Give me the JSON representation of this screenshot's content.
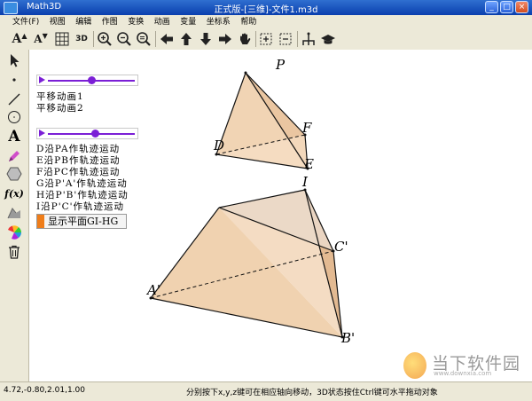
{
  "window": {
    "app_name": "Math3D",
    "title": "正式版-[三维]-文件1.m3d",
    "controls": [
      "_",
      "□",
      "×"
    ]
  },
  "menu": [
    "文件(F)",
    "视图",
    "编辑",
    "作图",
    "变换",
    "动画",
    "变量",
    "坐标系",
    "帮助"
  ],
  "toolbar": {
    "tools": [
      "font-increase-icon",
      "font-decrease-icon",
      "grid-icon",
      "3d-view-icon",
      "zoom-in-icon",
      "zoom-out-icon",
      "zoom-reset-icon",
      "arrow-left-icon",
      "arrow-up-icon",
      "arrow-down-icon",
      "arrow-right-icon",
      "pan-hand-icon",
      "add-frame-icon",
      "remove-frame-icon",
      "axes-icon",
      "hat-icon"
    ],
    "labels": {
      "font_up": "A",
      "font_down": "A",
      "threed": "3D"
    }
  },
  "side_tools": [
    "select-arrow-icon",
    "point-icon",
    "segment-icon",
    "circle-icon",
    "text-icon",
    "pen-icon",
    "polygon-icon",
    "function-icon",
    "shape-fill-icon",
    "color-icon",
    "trash-icon"
  ],
  "side_labels": {
    "text": "A",
    "func": "f(x)"
  },
  "sliders": [
    {
      "value": 0.5
    },
    {
      "value": 0.55
    }
  ],
  "animations_group1": [
    "平移动画1",
    "平移动画2"
  ],
  "animations_group2": [
    "D沿PA作轨迹运动",
    "E沿PB作轨迹运动",
    "F沿PC作轨迹运动",
    "G沿P'A'作轨迹运动",
    "H沿P'B'作轨迹运动",
    "I沿P'C'作轨迹运动"
  ],
  "show_button": "显示平面GI-HG",
  "points": {
    "P": "P",
    "D": "D",
    "E": "E",
    "F": "F",
    "I": "I",
    "C": "C'",
    "A": "A'",
    "B": "B'"
  },
  "status": {
    "coords": "4.72,-0.80,2.01,1.00",
    "hint": "分别按下x,y,z键可在相应轴向移动，3D状态按住Ctrl键可水平拖动对象"
  },
  "watermark": {
    "brand": "当下软件园",
    "url": "www.downxia.com"
  },
  "colors": {
    "accent": "#7b1fd6",
    "face": "#f0d2b0",
    "button_orange": "#ef7d1a"
  }
}
